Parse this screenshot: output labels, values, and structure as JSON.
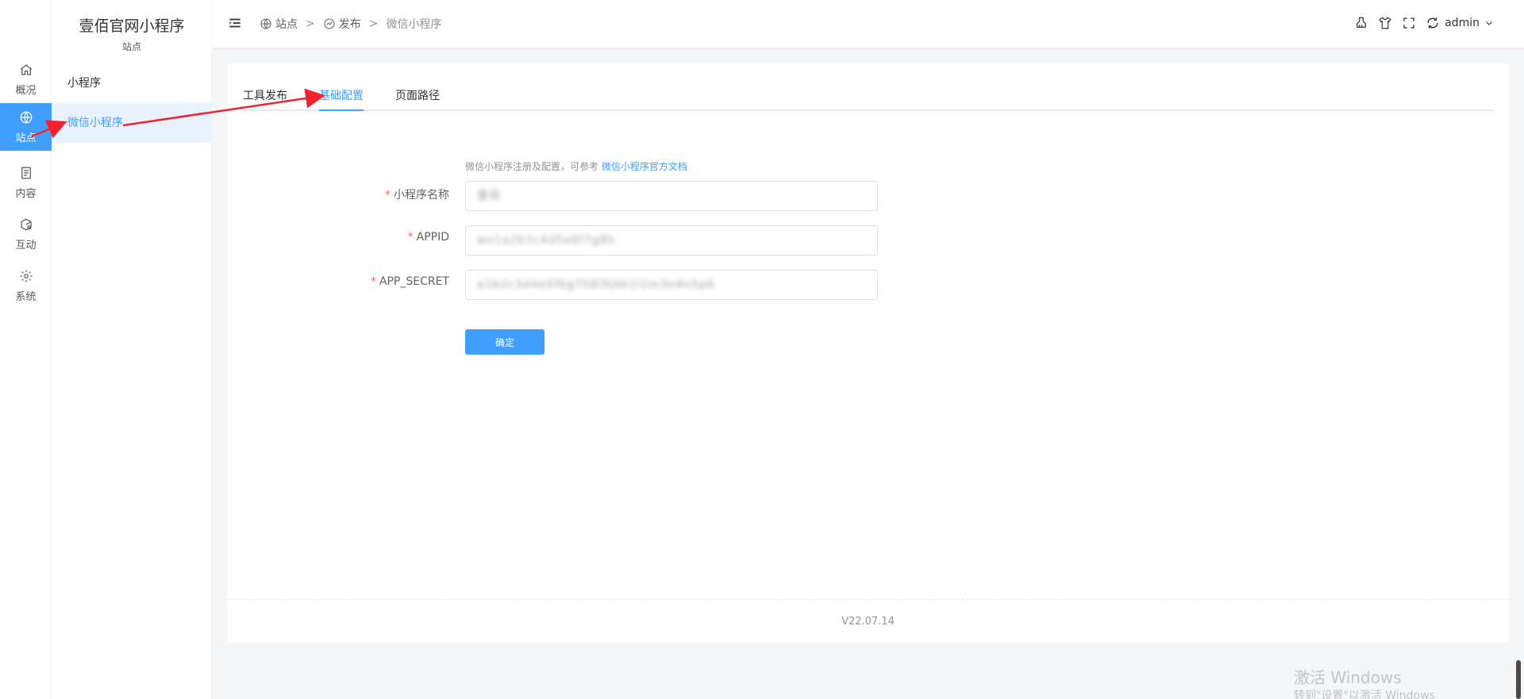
{
  "app": {
    "title": "壹佰官网小程序",
    "subtitle": "站点"
  },
  "rail": {
    "items": [
      {
        "label": "概况",
        "icon": "home-icon"
      },
      {
        "label": "站点",
        "icon": "globe-icon",
        "active": true
      },
      {
        "label": "内容",
        "icon": "document-icon"
      },
      {
        "label": "互动",
        "icon": "interaction-icon"
      },
      {
        "label": "系统",
        "icon": "gear-icon"
      }
    ]
  },
  "subnav": {
    "items": [
      {
        "label": "小程序"
      },
      {
        "label": "微信小程序",
        "active": true
      }
    ]
  },
  "header": {
    "breadcrumb": [
      {
        "label": "站点",
        "icon": "globe-icon"
      },
      {
        "label": "发布",
        "icon": "publish-icon"
      },
      {
        "label": "微信小程序"
      }
    ],
    "breadcrumb_separator": ">",
    "user": "admin"
  },
  "tabs": [
    {
      "label": "工具发布"
    },
    {
      "label": "基础配置",
      "active": true
    },
    {
      "label": "页面路径"
    }
  ],
  "form": {
    "hint": "微信小程序注册及配置，可参考",
    "hint_link": "微信小程序官方文档",
    "required_mark": "*",
    "fields": [
      {
        "label": "小程序名称",
        "value": "壹佰"
      },
      {
        "label": "APPID",
        "value": "wx1a2b3c4d5e6f7g8h"
      },
      {
        "label": "APP_SECRET",
        "value": "a1b2c3d4e5f6g7h8i9j0k1l2m3n4o5p6"
      }
    ],
    "submit_label": "确定"
  },
  "footer": {
    "version": "V22.07.14"
  },
  "watermark": {
    "line1": "激活 Windows",
    "line2": "转到\"设置\"以激活 Windows"
  },
  "colors": {
    "accent": "#409eff",
    "arrow": "#f5222d",
    "required": "#f56c6c"
  }
}
